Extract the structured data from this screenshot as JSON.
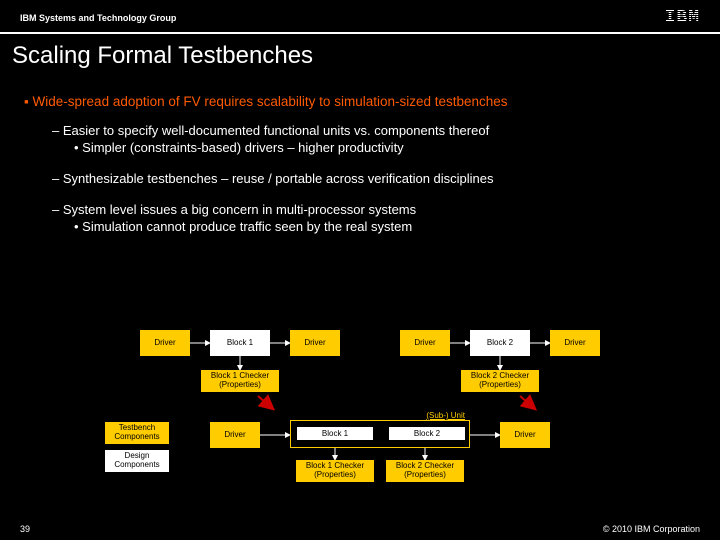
{
  "header": {
    "group": "IBM Systems and Technology Group",
    "logo": "IBM"
  },
  "title": "Scaling Formal Testbenches",
  "bullets": {
    "main": "Wide-spread adoption of FV requires scalability to simulation-sized testbenches",
    "s1a": "– Easier to specify well-documented functional units vs. components thereof",
    "s1a_sub": "• Simpler (constraints-based) drivers – higher productivity",
    "s1b": "– Synthesizable testbenches – reuse / portable across verification disciplines",
    "s1c": "– System level issues a big concern in multi-processor systems",
    "s1c_sub": "• Simulation cannot produce traffic seen by the real system"
  },
  "diagram": {
    "driver": "Driver",
    "block1": "Block 1",
    "block2": "Block 2",
    "checker1": "Block 1 Checker (Properties)",
    "checker2": "Block 2 Checker (Properties)",
    "subunit": "(Sub-) Unit",
    "legend_tb": "Testbench Components",
    "legend_dc": "Design Components"
  },
  "footer": {
    "page": "39",
    "copyright": "© 2010 IBM Corporation"
  }
}
